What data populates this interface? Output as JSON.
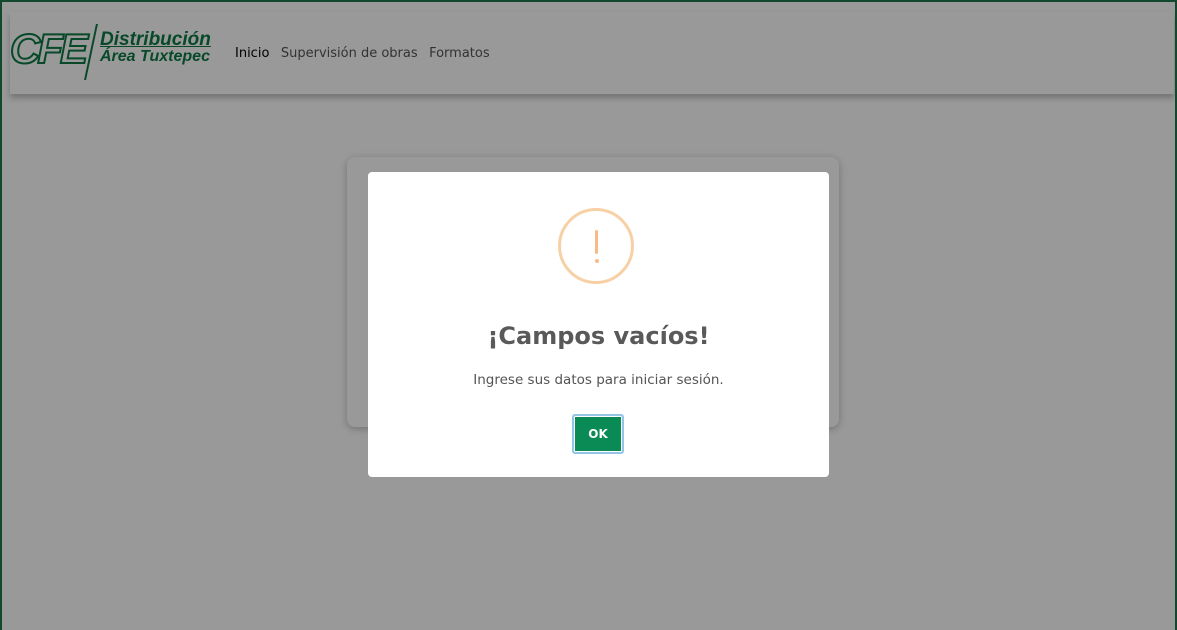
{
  "navbar": {
    "logo": {
      "mark": "CFE",
      "line1": "Distribución",
      "line2": "Área Tuxtepec"
    },
    "links": [
      {
        "label": "Inicio",
        "active": true
      },
      {
        "label": "Supervisión de obras",
        "active": false
      },
      {
        "label": "Formatos",
        "active": false
      }
    ]
  },
  "modal": {
    "icon": "warning-icon",
    "title": "¡Campos vacíos!",
    "text": "Ingrese sus datos para iniciar sesión.",
    "confirm_label": "OK"
  },
  "colors": {
    "brand_green": "#0c7a45",
    "button_green": "#0a8a55",
    "warning_orange": "#f8bb86"
  }
}
